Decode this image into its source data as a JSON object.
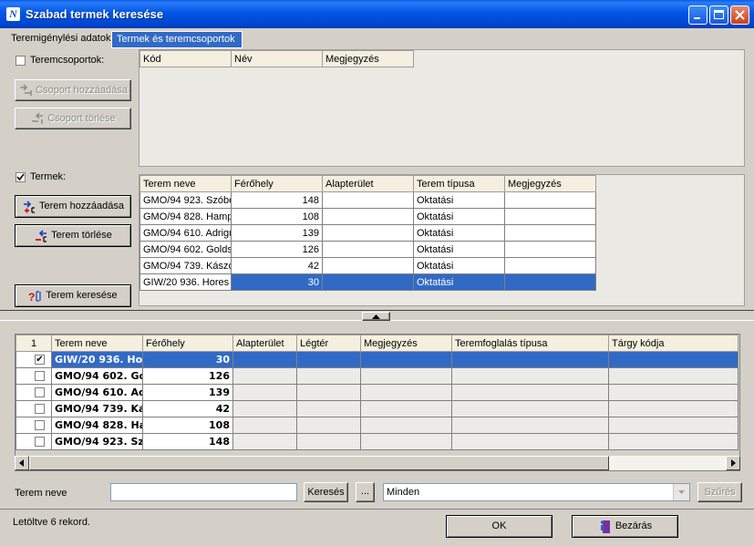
{
  "window": {
    "title": "Szabad termek keresése"
  },
  "tabs": [
    {
      "label": "Teremigénylési adatok"
    },
    {
      "label": "Termek és teremcsoportok"
    }
  ],
  "groups": {
    "checkbox_label": "Teremcsoportok:",
    "add_button": "Csoport hozzáadása",
    "remove_button": "Csoport törlése",
    "columns": [
      "Kód",
      "Név",
      "Megjegyzés"
    ]
  },
  "rooms": {
    "checkbox_label": "Termek:",
    "add_button": "Terem hozzáadása",
    "remove_button": "Terem törlése",
    "search_button": "Terem keresése",
    "columns": [
      "Terem neve",
      "Férőhely",
      "Alapterület",
      "Terem típusa",
      "Megjegyzés"
    ],
    "rows": [
      {
        "name": "GMO/94 923. Szóbe",
        "capacity": "148",
        "area": "",
        "type": "Oktatási",
        "note": ""
      },
      {
        "name": "GMO/94 828. Hamp",
        "capacity": "108",
        "area": "",
        "type": "Oktatási",
        "note": ""
      },
      {
        "name": "GMO/94 610. Adrigu",
        "capacity": "139",
        "area": "",
        "type": "Oktatási",
        "note": ""
      },
      {
        "name": "GMO/94 602. Golds",
        "capacity": "126",
        "area": "",
        "type": "Oktatási",
        "note": ""
      },
      {
        "name": "GMO/94 739. Kászo",
        "capacity": "42",
        "area": "",
        "type": "Oktatási",
        "note": ""
      },
      {
        "name": "GIW/20 936. Hores",
        "capacity": "30",
        "area": "",
        "type": "Oktatási",
        "note": ""
      }
    ]
  },
  "results": {
    "columns": [
      "1",
      "Terem neve",
      "Férőhely",
      "Alapterület",
      "Légtér",
      "Megjegyzés",
      "Teremfoglalás típusa",
      "Tárgy kódja"
    ],
    "rows": [
      {
        "checked": "✔",
        "name": "GIW/20 936. Hor",
        "capacity": "30"
      },
      {
        "checked": "",
        "name": "GMO/94 602. Go",
        "capacity": "126"
      },
      {
        "checked": "",
        "name": "GMO/94 610. Ad",
        "capacity": "139"
      },
      {
        "checked": "",
        "name": "GMO/94 739. Ká",
        "capacity": "42"
      },
      {
        "checked": "",
        "name": "GMO/94 828. Ha",
        "capacity": "108"
      },
      {
        "checked": "",
        "name": "GMO/94 923. Sz",
        "capacity": "148"
      }
    ]
  },
  "filter": {
    "label": "Terem neve",
    "input_value": "",
    "search_button": "Keresés",
    "ellipsis_button": "...",
    "select_value": "Minden",
    "filter_button": "Szűrés"
  },
  "status": {
    "text": "Letöltve 6 rekord.",
    "ok_button": "OK",
    "close_button": "Bezárás"
  },
  "colors": {
    "titlebar": "#0055e5",
    "selection": "#316ac5",
    "header": "#f4efdf"
  }
}
